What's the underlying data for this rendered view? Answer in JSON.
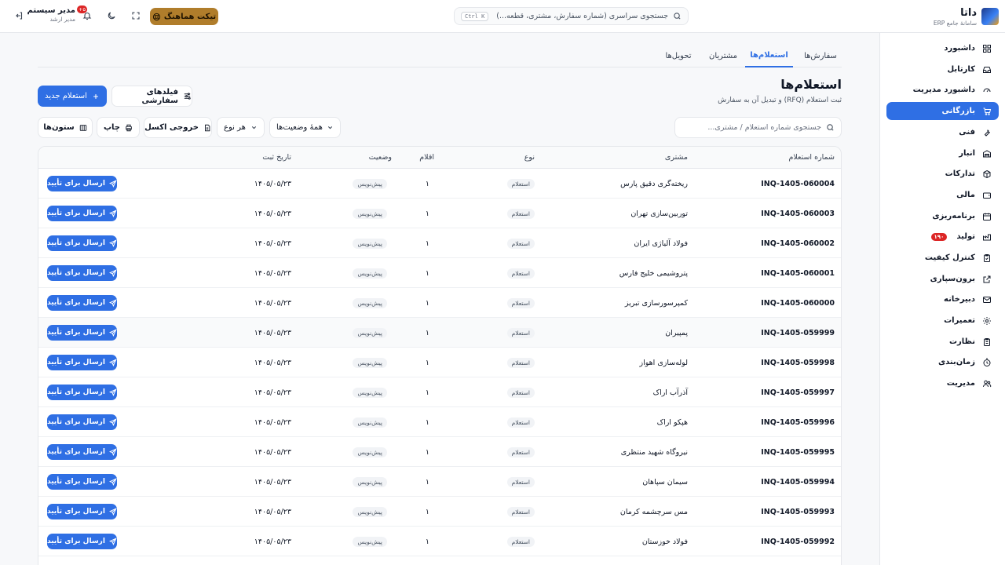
{
  "brand": {
    "name": "داتا",
    "subtitle": "سامانهٔ جامع ERP"
  },
  "header": {
    "search_placeholder": "جستجوی سراسری (شماره سفارش، مشتری، قطعه...)",
    "search_shortcut": "Ctrl K",
    "ticket_label": "تیکت هماهنگ",
    "user_name": "مدیر سیستم",
    "user_role": "مدیر ارشد",
    "notif_count": "۵+"
  },
  "sidebar": {
    "items": [
      {
        "label": "داشبورد",
        "icon": "grid-icon"
      },
      {
        "label": "کارتابل",
        "icon": "inbox-icon"
      },
      {
        "label": "داشبورد مدیریت",
        "icon": "gauge-icon"
      },
      {
        "label": "بازرگانی",
        "icon": "cart-icon",
        "active": true
      },
      {
        "label": "فنی",
        "icon": "wrench-icon"
      },
      {
        "label": "انبار",
        "icon": "warehouse-icon"
      },
      {
        "label": "تدارکات",
        "icon": "package-icon"
      },
      {
        "label": "مالی",
        "icon": "wallet-icon"
      },
      {
        "label": "برنامه‌ریزی",
        "icon": "calendar-icon"
      },
      {
        "label": "تولید",
        "icon": "factory-icon",
        "badge": "۱۹۰"
      },
      {
        "label": "کنترل کیفیت",
        "icon": "clipboard-check-icon"
      },
      {
        "label": "برون‌سپاری",
        "icon": "external-link-icon"
      },
      {
        "label": "دبیرخانه",
        "icon": "mail-icon"
      },
      {
        "label": "تعمیرات",
        "icon": "gear-icon"
      },
      {
        "label": "نظارت",
        "icon": "clipboard-icon"
      },
      {
        "label": "زمان‌بندی",
        "icon": "timer-icon"
      },
      {
        "label": "مدیریت",
        "icon": "users-icon"
      }
    ]
  },
  "tabs": [
    {
      "label": "سفارش‌ها"
    },
    {
      "label": "استعلام‌ها",
      "active": true
    },
    {
      "label": "مشتریان"
    },
    {
      "label": "تحویل‌ها"
    }
  ],
  "page": {
    "title": "استعلام‌ها",
    "subtitle": "ثبت استعلام (RFQ) و تبدیل آن به سفارش",
    "new_button": "استعلام جدید",
    "custom_fields_button": "فیلدهای سفارشی"
  },
  "filters": {
    "search_placeholder": "جستجوی شماره استعلام / مشتری...",
    "status_select": "همهٔ وضعیت‌ها",
    "type_select": "هر نوع",
    "excel_button": "خروجی اکسل",
    "print_button": "چاپ",
    "columns_button": "ستون‌ها"
  },
  "table": {
    "headers": {
      "number": "شماره استعلام",
      "customer": "مشتری",
      "type": "نوع",
      "items": "اقلام",
      "status": "وضعیت",
      "date": "تاریخ ثبت"
    },
    "action_label": "ارسال برای تأیید",
    "rows": [
      {
        "number": "INQ-1405-060004",
        "customer": "ریخته‌گری دقیق پارس",
        "type": "استعلام",
        "items": "۱",
        "status": "پیش‌نویس",
        "date": "۱۴۰۵/۰۵/۲۳"
      },
      {
        "number": "INQ-1405-060003",
        "customer": "توربین‌سازی تهران",
        "type": "استعلام",
        "items": "۱",
        "status": "پیش‌نویس",
        "date": "۱۴۰۵/۰۵/۲۳"
      },
      {
        "number": "INQ-1405-060002",
        "customer": "فولاد آلیاژی ایران",
        "type": "استعلام",
        "items": "۱",
        "status": "پیش‌نویس",
        "date": "۱۴۰۵/۰۵/۲۳"
      },
      {
        "number": "INQ-1405-060001",
        "customer": "پتروشیمی خلیج فارس",
        "type": "استعلام",
        "items": "۱",
        "status": "پیش‌نویس",
        "date": "۱۴۰۵/۰۵/۲۳"
      },
      {
        "number": "INQ-1405-060000",
        "customer": "کمپرسورسازی تبریز",
        "type": "استعلام",
        "items": "۱",
        "status": "پیش‌نویس",
        "date": "۱۴۰۵/۰۵/۲۳"
      },
      {
        "number": "INQ-1405-059999",
        "customer": "پمپیران",
        "type": "استعلام",
        "items": "۱",
        "status": "پیش‌نویس",
        "date": "۱۴۰۵/۰۵/۲۳"
      },
      {
        "number": "INQ-1405-059998",
        "customer": "لوله‌سازی اهواز",
        "type": "استعلام",
        "items": "۱",
        "status": "پیش‌نویس",
        "date": "۱۴۰۵/۰۵/۲۳"
      },
      {
        "number": "INQ-1405-059997",
        "customer": "آذرآب اراک",
        "type": "استعلام",
        "items": "۱",
        "status": "پیش‌نویس",
        "date": "۱۴۰۵/۰۵/۲۳"
      },
      {
        "number": "INQ-1405-059996",
        "customer": "هپکو اراک",
        "type": "استعلام",
        "items": "۱",
        "status": "پیش‌نویس",
        "date": "۱۴۰۵/۰۵/۲۳"
      },
      {
        "number": "INQ-1405-059995",
        "customer": "نیروگاه شهید منتظری",
        "type": "استعلام",
        "items": "۱",
        "status": "پیش‌نویس",
        "date": "۱۴۰۵/۰۵/۲۳"
      },
      {
        "number": "INQ-1405-059994",
        "customer": "سیمان سپاهان",
        "type": "استعلام",
        "items": "۱",
        "status": "پیش‌نویس",
        "date": "۱۴۰۵/۰۵/۲۳"
      },
      {
        "number": "INQ-1405-059993",
        "customer": "مس سرچشمه کرمان",
        "type": "استعلام",
        "items": "۱",
        "status": "پیش‌نویس",
        "date": "۱۴۰۵/۰۵/۲۳"
      },
      {
        "number": "INQ-1405-059992",
        "customer": "فولاد خوزستان",
        "type": "استعلام",
        "items": "۱",
        "status": "پیش‌نویس",
        "date": "۱۴۰۵/۰۵/۲۳"
      }
    ]
  },
  "colors": {
    "accent": "#2f6fe4",
    "ticket": "#b07d2b",
    "danger": "#dc2626"
  }
}
